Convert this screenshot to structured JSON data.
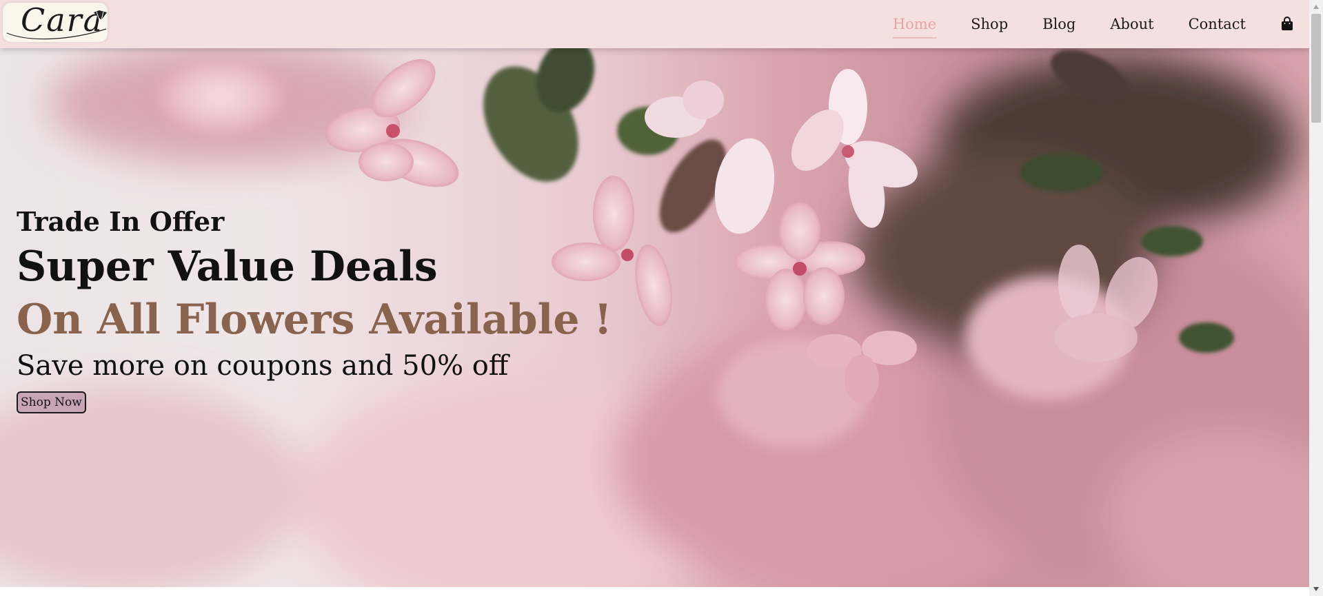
{
  "brand": {
    "logo_text": "Cara",
    "logo_icon": "diamond-icon"
  },
  "nav": {
    "items": [
      {
        "label": "Home",
        "active": true
      },
      {
        "label": "Shop",
        "active": false
      },
      {
        "label": "Blog",
        "active": false
      },
      {
        "label": "About",
        "active": false
      },
      {
        "label": "Contact",
        "active": false
      }
    ],
    "cart_icon": "shopping-bag-icon"
  },
  "hero": {
    "kicker": "Trade In Offer",
    "headline": "Super Value Deals",
    "highlight": "On All Flowers Available !",
    "subtext": "Save more on coupons and 50% off",
    "button_label": "Shop Now",
    "background": "pink cherry blossom flowers"
  },
  "colors": {
    "header_bg": "#f5e0e0",
    "nav_active": "#e8a3a3",
    "highlight": "#8a634f",
    "button_bg": "#c7a5b5"
  }
}
